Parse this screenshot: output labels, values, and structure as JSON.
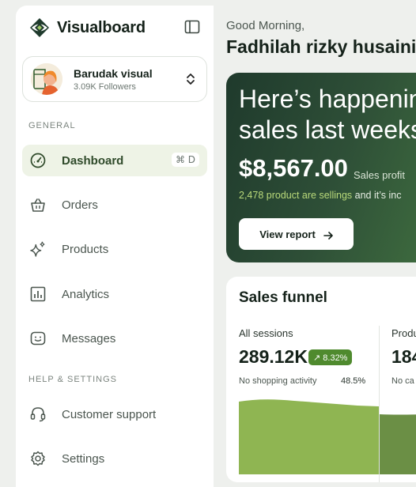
{
  "brand": {
    "name": "Visualboard"
  },
  "account": {
    "name": "Barudak visual",
    "followers": "3.09K Followers"
  },
  "sidebar": {
    "general_label": "GENERAL",
    "items": [
      {
        "label": "Dashboard",
        "icon": "gauge-icon",
        "shortcut": "⌘ D",
        "active": true
      },
      {
        "label": "Orders",
        "icon": "basket-icon"
      },
      {
        "label": "Products",
        "icon": "sparkle-icon"
      },
      {
        "label": "Analytics",
        "icon": "bar-chart-icon"
      },
      {
        "label": "Messages",
        "icon": "chat-icon"
      }
    ],
    "help_label": "HELP & SETTINGS",
    "help_items": [
      {
        "label": "Customer support",
        "icon": "headset-icon"
      },
      {
        "label": "Settings",
        "icon": "gear-icon"
      }
    ]
  },
  "header": {
    "greeting": "Good Morning,",
    "user": "Fadhilah rizky husaini"
  },
  "hero": {
    "title_line1": "Here’s happenin",
    "title_line2": "sales last weeks",
    "amount": "$8,567.00",
    "amount_label": "Sales profit",
    "note_highlight": "2,478 product are sellings",
    "note_rest": " and it’s inc",
    "button": "View report"
  },
  "funnel": {
    "title": "Sales funnel",
    "columns": [
      {
        "label": "All sessions",
        "value": "289.12K",
        "badge": "↗ 8.32%",
        "sub": "No shopping activity",
        "sub_pct": "48.5%"
      },
      {
        "label": "Produ",
        "value": "184",
        "sub": "No ca"
      }
    ]
  },
  "colors": {
    "accent": "#4f8a2e",
    "hero_dark": "#1f3a2c",
    "active_bg": "#eef3e6",
    "chart_light": "#8fb552",
    "chart_dark": "#6b8f45"
  }
}
